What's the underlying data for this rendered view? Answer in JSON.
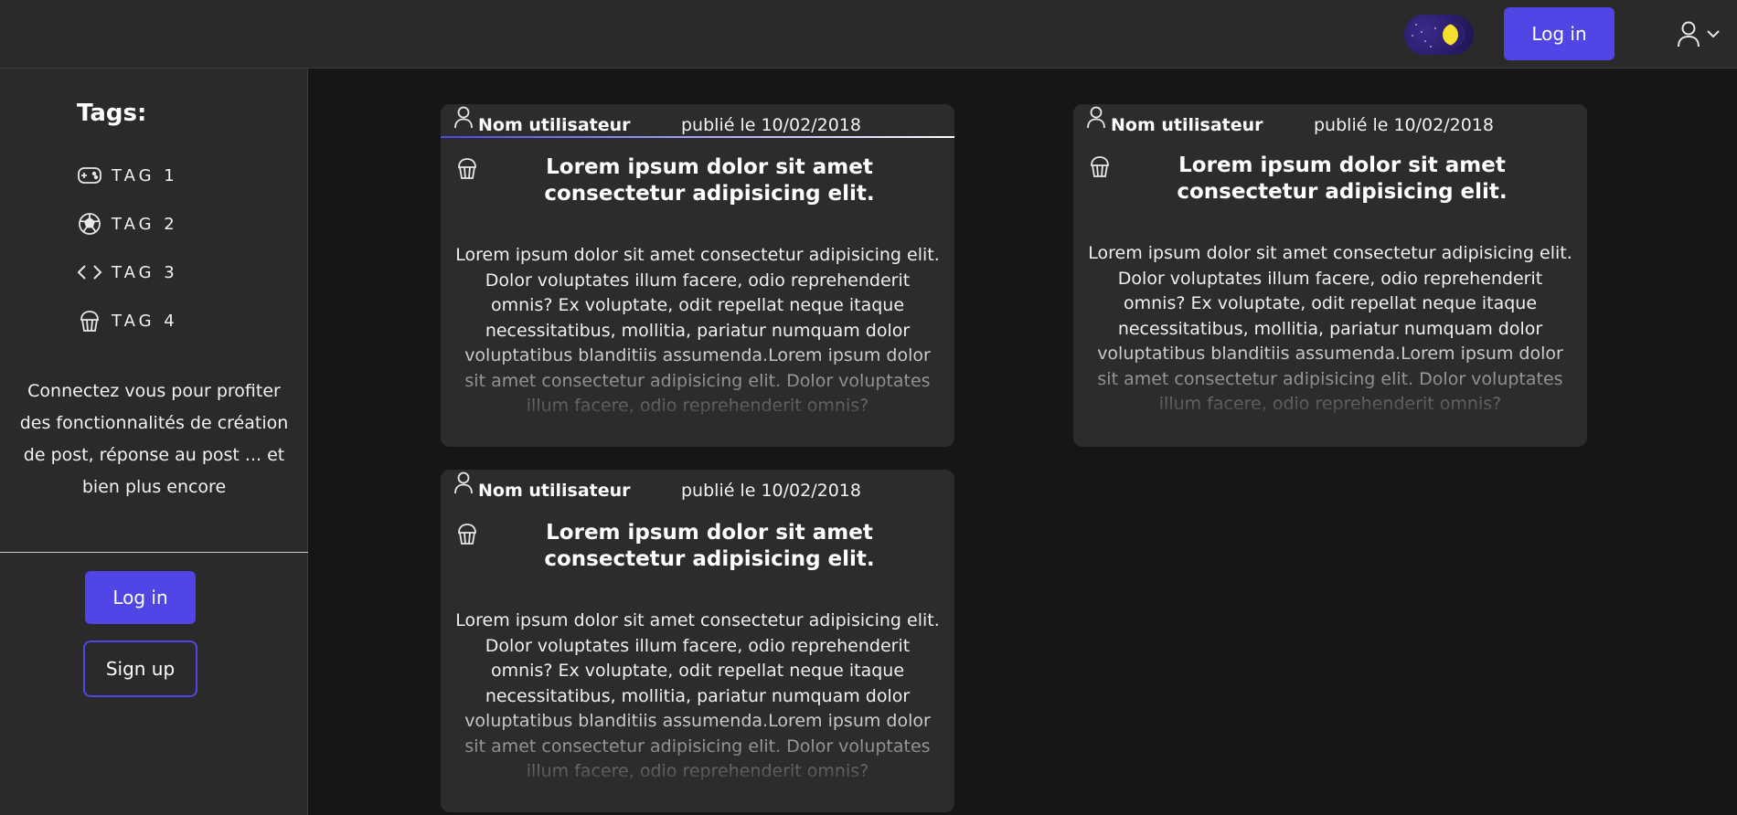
{
  "header": {
    "login_label": "Log in",
    "theme_icon": "moon-icon",
    "user_icon": "user-icon",
    "menu_icon": "chevron-down-icon"
  },
  "sidebar": {
    "tags_title": "Tags:",
    "tags": [
      {
        "label": "TAG 1",
        "icon": "gamepad-icon"
      },
      {
        "label": "TAG 2",
        "icon": "football-icon"
      },
      {
        "label": "TAG 3",
        "icon": "code-icon"
      },
      {
        "label": "TAG 4",
        "icon": "cupcake-icon"
      }
    ],
    "info_text": "Connectez vous pour profiter des fonctionnalités de création de post, réponse au post ... et bien plus encore",
    "login_label": "Log in",
    "signup_label": "Sign up"
  },
  "posts": [
    {
      "username": "Nom utilisateur",
      "date": "publié le 10/02/2018",
      "title": "Lorem ipsum dolor sit amet consectetur adipisicing elit.",
      "body": "Lorem ipsum dolor sit amet consectetur adipisicing elit. Dolor voluptates illum facere, odio reprehenderit omnis? Ex voluptate, odit repellat neque itaque necessitatibus, mollitia, pariatur numquam dolor voluptatibus blanditiis assumenda.Lorem ipsum dolor sit amet consectetur adipisicing elit. Dolor voluptates illum facere, odio reprehenderit omnis?",
      "category_icon": "cupcake-icon"
    },
    {
      "username": "Nom utilisateur",
      "date": "publié le 10/02/2018",
      "title": "Lorem ipsum dolor sit amet consectetur adipisicing elit.",
      "body": "Lorem ipsum dolor sit amet consectetur adipisicing elit. Dolor voluptates illum facere, odio reprehenderit omnis? Ex voluptate, odit repellat neque itaque necessitatibus, mollitia, pariatur numquam dolor voluptatibus blanditiis assumenda.Lorem ipsum dolor sit amet consectetur adipisicing elit. Dolor voluptates illum facere, odio reprehenderit omnis?",
      "category_icon": "cupcake-icon"
    },
    {
      "username": "Nom utilisateur",
      "date": "publié le 10/02/2018",
      "title": "Lorem ipsum dolor sit amet consectetur adipisicing elit.",
      "body": "Lorem ipsum dolor sit amet consectetur adipisicing elit. Dolor voluptates illum facere, odio reprehenderit omnis? Ex voluptate, odit repellat neque itaque necessitatibus, mollitia, pariatur numquam dolor voluptatibus blanditiis assumenda.Lorem ipsum dolor sit amet consectetur adipisicing elit. Dolor voluptates illum facere, odio reprehenderit omnis?",
      "category_icon": "cupcake-icon"
    }
  ],
  "colors": {
    "accent": "#4f46e5",
    "background": "#161616",
    "panel": "#2a2a2a",
    "card": "#2c2c2c",
    "moon": "#f5e02e"
  }
}
